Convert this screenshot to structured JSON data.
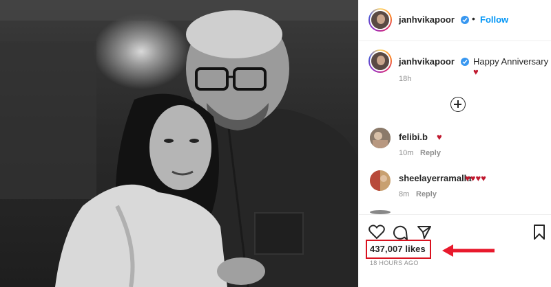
{
  "post": {
    "author": "janhvikapoor",
    "follow_label": "Follow",
    "separator": "•"
  },
  "caption": {
    "username": "janhvikapoor",
    "text": "Happy Anniversary ",
    "heart": "♥",
    "time": "18h"
  },
  "comments": [
    {
      "username": "felibi.b",
      "text": "♥",
      "time": "10m",
      "reply_label": "Reply"
    },
    {
      "username": "sheelayerramalla",
      "text": "♥♥♥♥",
      "time": "8m",
      "reply_label": "Reply"
    }
  ],
  "footer": {
    "likes": "437,007 likes",
    "posted": "18 HOURS AGO"
  },
  "colors": {
    "accent": "#0095f6",
    "highlight": "#d9121f",
    "heart": "#c0192f"
  }
}
